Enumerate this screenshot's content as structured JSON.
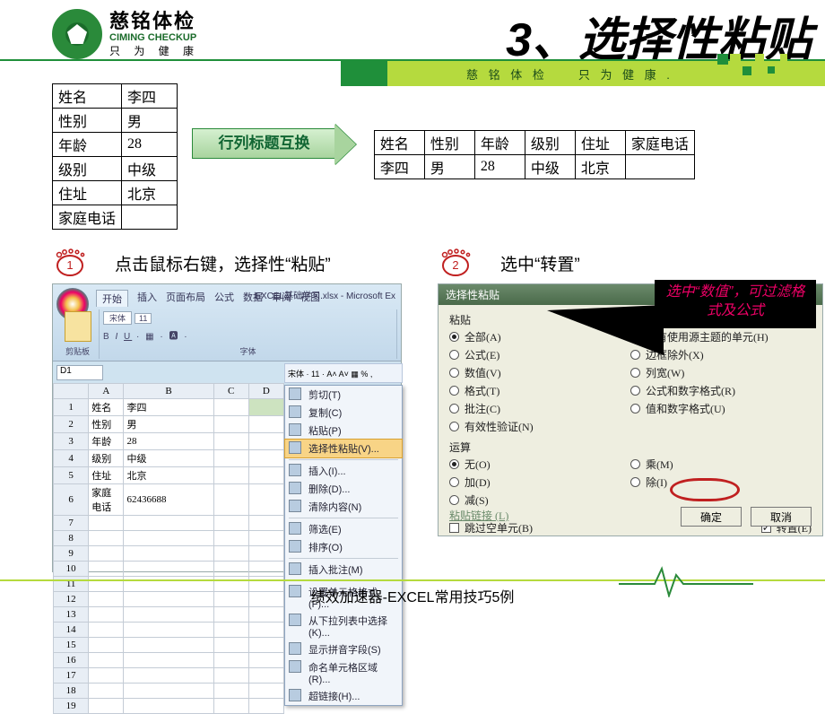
{
  "brand": {
    "name_cn": "慈铭体检",
    "name_en": "CIMING CHECKUP",
    "slogan": "只 为 健 康",
    "bar_text": "慈 铭 体 检　　只 为 健 康 ."
  },
  "title": "3、选择性粘贴",
  "arrow_label": "行列标题互换",
  "vertical_table": {
    "rows": [
      {
        "k": "姓名",
        "v": "李四"
      },
      {
        "k": "性别",
        "v": "男"
      },
      {
        "k": "年龄",
        "v": "28"
      },
      {
        "k": "级别",
        "v": "中级"
      },
      {
        "k": "住址",
        "v": "北京"
      },
      {
        "k": "家庭电话",
        "v": ""
      }
    ]
  },
  "horizontal_table": {
    "header": [
      "姓名",
      "性别",
      "年龄",
      "级别",
      "住址",
      "家庭电话"
    ],
    "row": [
      "李四",
      "男",
      "28",
      "中级",
      "北京",
      ""
    ]
  },
  "steps": {
    "s1_num": "1",
    "s1_text": "点击鼠标右键，选择性“粘贴”",
    "s2_num": "2",
    "s2_text": "选中“转置”"
  },
  "excel": {
    "window_title": "EXCEL基础学习.xlsx - Microsoft Ex",
    "tabs": [
      "开始",
      "插入",
      "页面布局",
      "公式",
      "数据",
      "审阅",
      "视图"
    ],
    "groups": [
      "剪贴板",
      "字体"
    ],
    "font": "宋体",
    "font_size": "11",
    "namebox": "D1",
    "columns": [
      "",
      "A",
      "B",
      "C",
      "D"
    ],
    "rows": [
      [
        "1",
        "姓名",
        "李四",
        "",
        ""
      ],
      [
        "2",
        "性别",
        "男",
        "",
        ""
      ],
      [
        "3",
        "年龄",
        "28",
        "",
        ""
      ],
      [
        "4",
        "级别",
        "中级",
        "",
        ""
      ],
      [
        "5",
        "住址",
        "北京",
        "",
        ""
      ],
      [
        "6",
        "家庭电话",
        "62436688",
        "",
        ""
      ],
      [
        "7",
        "",
        "",
        "",
        ""
      ],
      [
        "8",
        "",
        "",
        "",
        ""
      ],
      [
        "9",
        "",
        "",
        "",
        ""
      ],
      [
        "10",
        "",
        "",
        "",
        ""
      ],
      [
        "11",
        "",
        "",
        "",
        ""
      ],
      [
        "12",
        "",
        "",
        "",
        ""
      ],
      [
        "13",
        "",
        "",
        "",
        ""
      ],
      [
        "14",
        "",
        "",
        "",
        ""
      ],
      [
        "15",
        "",
        "",
        "",
        ""
      ],
      [
        "16",
        "",
        "",
        "",
        ""
      ],
      [
        "17",
        "",
        "",
        "",
        ""
      ],
      [
        "18",
        "",
        "",
        "",
        ""
      ],
      [
        "19",
        "",
        "",
        "",
        ""
      ]
    ],
    "mini_toolbar": "宋体  · 11 · A˄ A˅ ▦ % ,",
    "context_menu": [
      "剪切(T)",
      "复制(C)",
      "粘贴(P)",
      "__HL__选择性粘贴(V)...",
      "__SEP__",
      "插入(I)...",
      "删除(D)...",
      "清除内容(N)",
      "__SEP__",
      "筛选(E)",
      "排序(O)",
      "__SEP__",
      "插入批注(M)",
      "__SEP__",
      "设置单元格格式(F)...",
      "从下拉列表中选择(K)...",
      "显示拼音字段(S)",
      "命名单元格区域(R)...",
      "超链接(H)..."
    ]
  },
  "dialog": {
    "title": "选择性粘贴",
    "paste_label": "粘贴",
    "paste_left": [
      {
        "t": "全部(A)",
        "on": true
      },
      {
        "t": "公式(E)",
        "on": false
      },
      {
        "t": "数值(V)",
        "on": false
      },
      {
        "t": "格式(T)",
        "on": false
      },
      {
        "t": "批注(C)",
        "on": false
      },
      {
        "t": "有效性验证(N)",
        "on": false
      }
    ],
    "paste_right": [
      {
        "t": "所有使用源主题的单元(H)",
        "on": false
      },
      {
        "t": "边框除外(X)",
        "on": false
      },
      {
        "t": "列宽(W)",
        "on": false
      },
      {
        "t": "公式和数字格式(R)",
        "on": false
      },
      {
        "t": "值和数字格式(U)",
        "on": false
      }
    ],
    "op_label": "运算",
    "op_left": [
      {
        "t": "无(O)",
        "on": true
      },
      {
        "t": "加(D)",
        "on": false
      },
      {
        "t": "减(S)",
        "on": false
      }
    ],
    "op_right": [
      {
        "t": "乘(M)",
        "on": false
      },
      {
        "t": "除(I)",
        "on": false
      }
    ],
    "skip_blanks": "跳过空单元(B)",
    "transpose": "转置(E)",
    "transpose_on": true,
    "paste_link": "粘贴链接 (L)",
    "ok": "确定",
    "cancel": "取消"
  },
  "callout": "选中“数值”，可过滤格式及公式",
  "footer": "绩效加速器-EXCEL常用技巧5例"
}
